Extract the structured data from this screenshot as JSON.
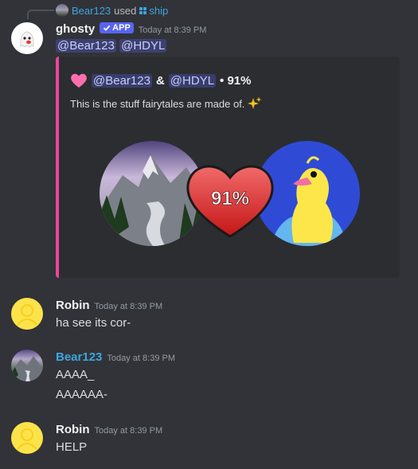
{
  "reply": {
    "user": "Bear123",
    "used": "used",
    "command": "ship"
  },
  "messages": {
    "ghosty": {
      "username": "ghosty",
      "badge": "APP",
      "time": "Today at 8:39 PM",
      "mention1": "@Bear123",
      "mention2": "@HDYL"
    },
    "robin1": {
      "username": "Robin",
      "time": "Today at 8:39 PM",
      "text": "ha see its cor-"
    },
    "bear": {
      "username": "Bear123",
      "time": "Today at 8:39 PM",
      "line1": "AAAA_",
      "line2": "AAAAAA-"
    },
    "robin2": {
      "username": "Robin",
      "time": "Today at 8:39 PM",
      "text": "HELP"
    }
  },
  "embed": {
    "mention1": "@Bear123",
    "amp": "&",
    "mention2": "@HDYL",
    "score": "• 91%",
    "description": "This is the stuff fairytales are made of.",
    "heart_percent": "91%",
    "accent_color": "#eb459f"
  },
  "icons": [
    "sparkles-icon",
    "pink-heart-icon",
    "checkmark-icon",
    "grid-icon"
  ]
}
